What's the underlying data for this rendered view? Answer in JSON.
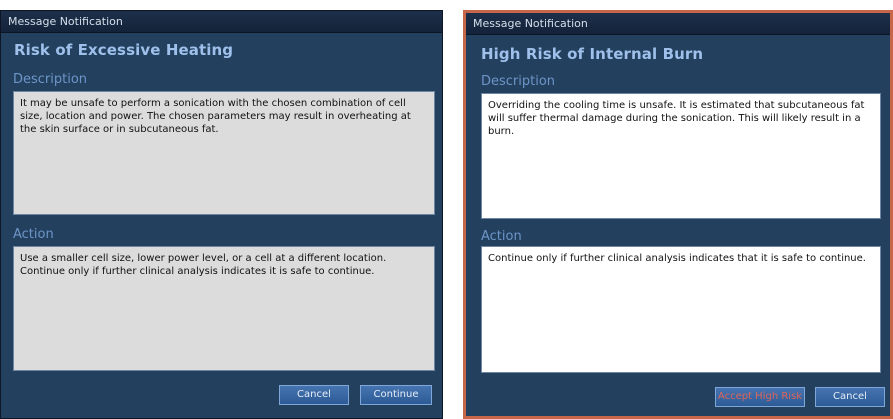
{
  "left_dialog": {
    "window_title": "Message Notification",
    "heading": "Risk of Excessive Heating",
    "description_label": "Description",
    "description_text": "It may be unsafe to perform a sonication with the chosen combination of cell size, location and power. The chosen parameters may result in overheating at the skin surface or in subcutaneous fat.",
    "action_label": "Action",
    "action_text": "Use a smaller cell size, lower power level, or a cell at a different location. Continue only if further clinical analysis indicates it is safe to continue.",
    "buttons": {
      "cancel": "Cancel",
      "continue": "Continue"
    }
  },
  "right_dialog": {
    "window_title": "Message Notification",
    "heading": "High Risk of Internal Burn",
    "description_label": "Description",
    "description_text": "Overriding the cooling time is unsafe. It is estimated that subcutaneous fat will suffer thermal damage during the sonication. This will likely result in a burn.",
    "action_label": "Action",
    "action_text": "Continue only if further clinical analysis indicates that it is safe to continue.",
    "buttons": {
      "accept_high_risk": "Accept High Risk",
      "cancel": "Cancel"
    }
  },
  "colors": {
    "dialog_background": "#23405e",
    "heading_text": "#9ec0ea",
    "section_label": "#6d95c8",
    "highlight_border": "#c8664a",
    "accept_risk_text": "#e0645a",
    "button_background": "#3a68a5"
  }
}
